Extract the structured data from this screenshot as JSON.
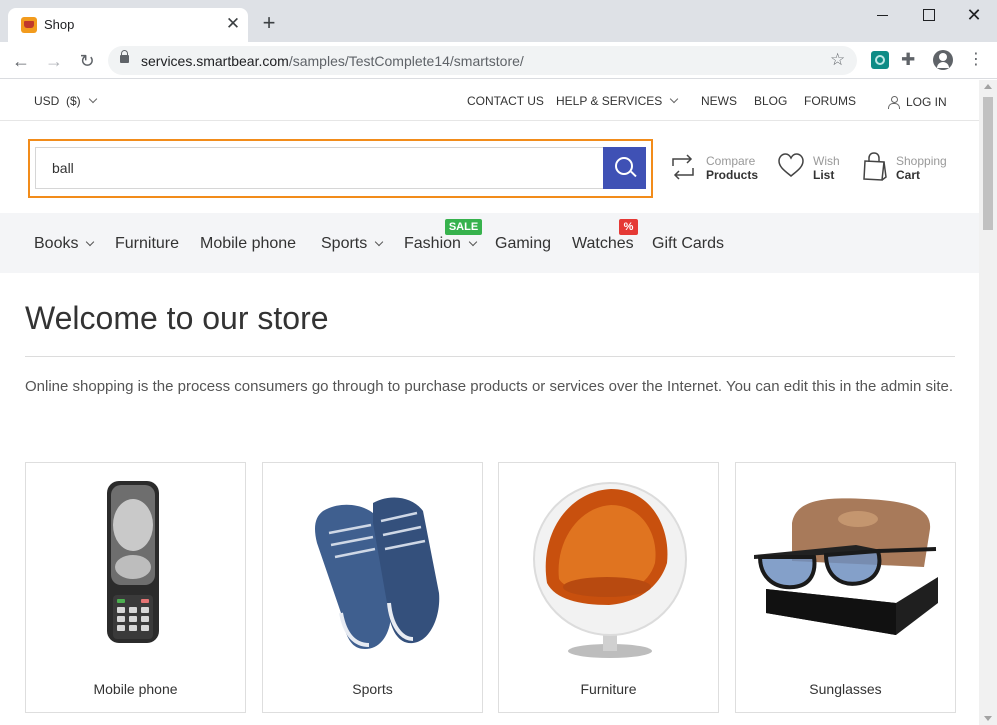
{
  "browser": {
    "tab_title": "Shop",
    "url_host": "services.smartbear.com",
    "url_path": "/samples/TestComplete14/smartstore/"
  },
  "topbar": {
    "currency": "USD  ($)",
    "contact": "CONTACT US",
    "help": "HELP & SERVICES",
    "news": "NEWS",
    "blog": "BLOG",
    "forums": "FORUMS",
    "login": "LOG IN"
  },
  "search": {
    "value": "ball"
  },
  "utilities": {
    "compare_1": "Compare",
    "compare_2": "Products",
    "wish_1": "Wish",
    "wish_2": "List",
    "cart_1": "Shopping",
    "cart_2": "Cart"
  },
  "categories": [
    {
      "label": "Books"
    },
    {
      "label": "Furniture"
    },
    {
      "label": "Mobile phone"
    },
    {
      "label": "Sports"
    },
    {
      "label": "Fashion",
      "badge": "SALE"
    },
    {
      "label": "Gaming"
    },
    {
      "label": "Watches",
      "badge": "%"
    },
    {
      "label": "Gift Cards"
    }
  ],
  "colors": {
    "accent": "#3f51b5",
    "highlight": "#f28c1a",
    "sale_badge": "#37b24d",
    "percent_badge": "#e53935"
  },
  "main": {
    "title": "Welcome to our store",
    "intro": "Online shopping is the process consumers go through to purchase products or services over the Internet. You can edit this in the admin site."
  },
  "products": [
    {
      "label": "Mobile phone"
    },
    {
      "label": "Sports"
    },
    {
      "label": "Furniture"
    },
    {
      "label": "Sunglasses"
    }
  ]
}
